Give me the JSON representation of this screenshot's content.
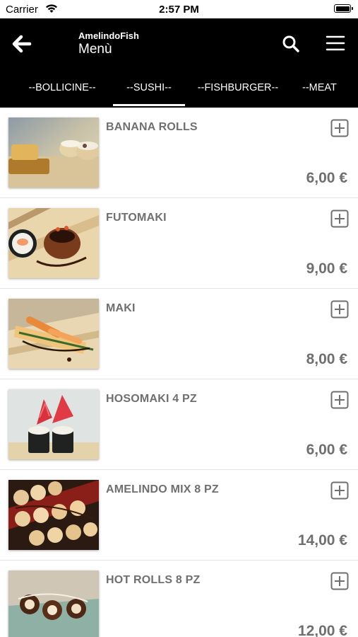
{
  "status_bar": {
    "carrier": "Carrier",
    "time": "2:57 PM"
  },
  "header": {
    "app_name": "AmelindoFish",
    "title": "Menù"
  },
  "tabs": [
    {
      "label": "--BOLLICINE--"
    },
    {
      "label": "--SUSHI--",
      "selected": true
    },
    {
      "label": "--FISHBURGER--"
    },
    {
      "label": "--MEAT"
    }
  ],
  "items": [
    {
      "name": "BANANA ROLLS",
      "price": "6,00 €"
    },
    {
      "name": "FUTOMAKI",
      "price": "9,00 €"
    },
    {
      "name": "MAKI",
      "price": "8,00 €"
    },
    {
      "name": "HOSOMAKI 4 PZ",
      "price": "6,00 €"
    },
    {
      "name": "AMELINDO MIX 8 PZ",
      "price": "14,00 €"
    },
    {
      "name": "HOT ROLLS 8 PZ",
      "price": "12,00 €"
    }
  ],
  "colors": {
    "header_bg": "#000000",
    "text_gray": "#6f6f6f",
    "divider": "#e2e2e2"
  },
  "icons": [
    "wifi-icon",
    "battery-icon",
    "back-arrow-icon",
    "search-icon",
    "hamburger-menu-icon",
    "add-square-icon"
  ]
}
